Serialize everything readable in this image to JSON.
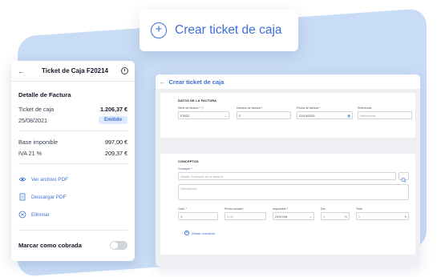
{
  "create_pill": {
    "label": "Crear ticket de caja"
  },
  "card": {
    "title": "Ticket de Caja F20214",
    "section_title": "Detalle de Factura",
    "ticket_label": "Ticket de caja",
    "ticket_amount": "1.206,37 €",
    "date": "25/08/2021",
    "status": "Emitido",
    "base_label": "Base imponible",
    "base_value": "997,00 €",
    "iva_label": "IVA 21 %",
    "iva_value": "209,37 €",
    "actions": [
      "Ver archivo PDF",
      "Descargar PDF",
      "Eliminar"
    ],
    "toggle_label": "Marcar como cobrada"
  },
  "form": {
    "title": "Crear ticket de caja",
    "datos_section": "DATOS DE LA FACTURA",
    "serie_label": "Serie de factura *",
    "serie_value": "F2022",
    "numero_label": "Número de factura *",
    "numero_value": "2",
    "fecha_label": "Fecha de factura *",
    "fecha_value": "21/10/2021",
    "referencia_label": "Referencia",
    "referencia_placeholder": "Referencia",
    "conceptos_section": "CONCEPTOS",
    "concepto_label": "Concepto *",
    "concepto_placeholder": "Añadir Concepto de la factura",
    "descripcion_placeholder": "Descripción",
    "cant_label": "Cant. *",
    "cant_value": "1",
    "precio_label": "Precio unidad *",
    "precio_placeholder": "0,00",
    "impuestos_label": "Impuestos *",
    "impuestos_value": "21% IVA",
    "dto_label": "Dto",
    "dto_value": "0",
    "total_label": "Total",
    "total_value": "0",
    "add_concept": "Añadir concepto"
  }
}
